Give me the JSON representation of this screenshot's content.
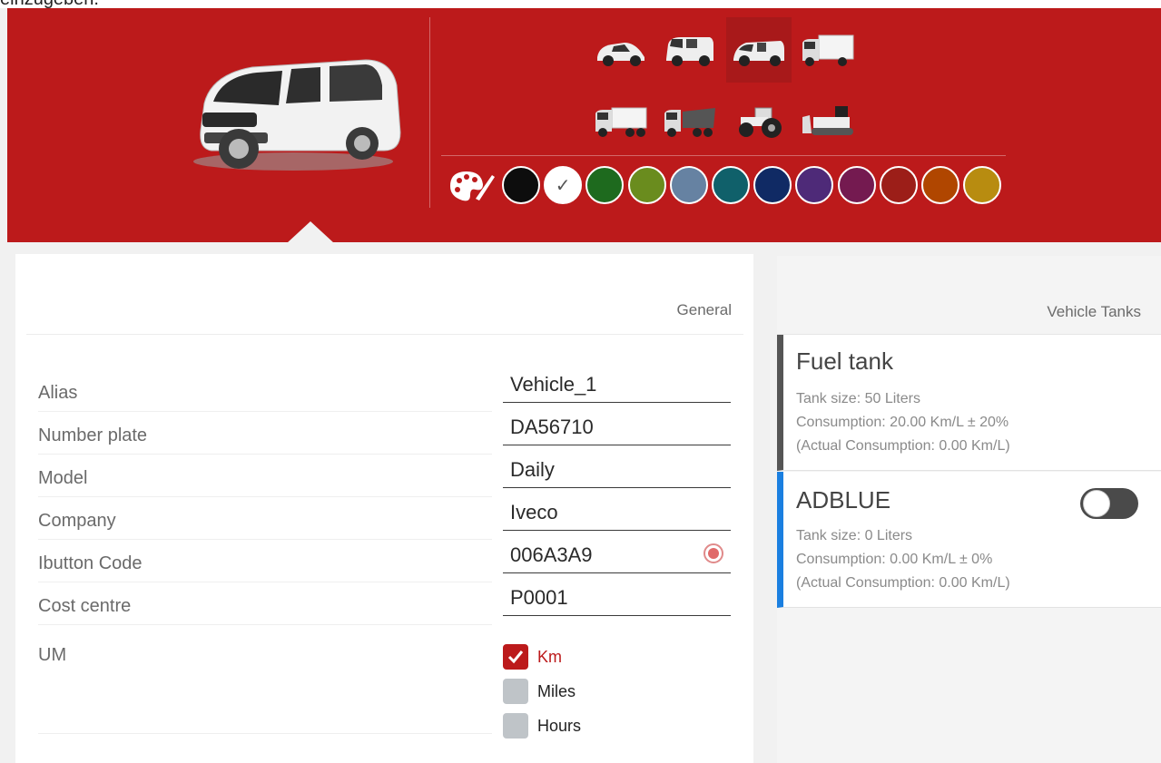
{
  "page": {
    "top_text": "einzugeben."
  },
  "vehicle_types": [
    {
      "icon": "car-icon",
      "selected": false
    },
    {
      "icon": "small-van-icon",
      "selected": false
    },
    {
      "icon": "van-icon",
      "selected": true
    },
    {
      "icon": "box-truck-icon",
      "selected": false
    },
    {
      "icon": "semi-truck-icon",
      "selected": false
    },
    {
      "icon": "dump-truck-icon",
      "selected": false
    },
    {
      "icon": "tractor-icon",
      "selected": false
    },
    {
      "icon": "bulldozer-icon",
      "selected": false
    }
  ],
  "colors": [
    "#0d0d0d",
    "#ffffff",
    "#1e6a1e",
    "#6a8c1e",
    "#6682a2",
    "#10606a",
    "#102a64",
    "#4e2a78",
    "#741a50",
    "#9c1e18",
    "#b04600",
    "#b88c10"
  ],
  "selected_color_index": 1,
  "general": {
    "title": "General",
    "rows": [
      {
        "label": "Alias",
        "value": "Vehicle_1"
      },
      {
        "label": "Number plate",
        "value": "DA56710"
      },
      {
        "label": "Model",
        "value": "Daily"
      },
      {
        "label": "Company",
        "value": "Iveco"
      },
      {
        "label": "Ibutton Code",
        "value": "006A3A9"
      },
      {
        "label": "Cost centre",
        "value": "P0001"
      }
    ],
    "um_label": "UM",
    "um_options": [
      {
        "label": "Km",
        "checked": true
      },
      {
        "label": "Miles",
        "checked": false
      },
      {
        "label": "Hours",
        "checked": false
      }
    ]
  },
  "tanks": {
    "title": "Vehicle Tanks",
    "items": [
      {
        "name": "Fuel tank",
        "size": "Tank size: 50 Liters",
        "consumption": "Consumption: 20.00 Km/L ± 20%",
        "actual": "(Actual Consumption: 0.00 Km/L)"
      },
      {
        "name": "ADBLUE",
        "size": "Tank size: 0 Liters",
        "consumption": "Consumption: 0.00 Km/L ± 0%",
        "actual": "(Actual Consumption: 0.00 Km/L)",
        "enabled": false
      }
    ]
  }
}
